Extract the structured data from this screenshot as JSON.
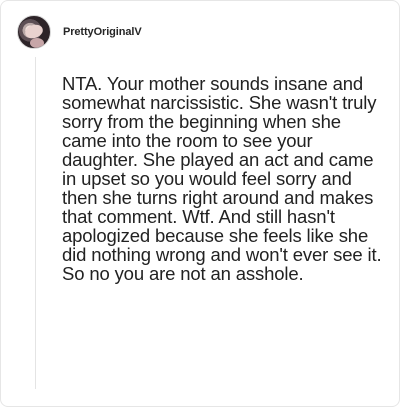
{
  "post": {
    "username": "PrettyOriginalV",
    "avatar_icon": "profile-avatar",
    "comment": "NTA. Your mother sounds insane and somewhat narcissistic. She wasn't truly sorry from the beginning when she came into the room to see your daughter. She played an act and came in upset so you would feel sorry and then she turns right around and makes that comment. Wtf. And still hasn't apologized because she feels like she did nothing wrong and won't ever see it. So no you are not an asshole."
  }
}
